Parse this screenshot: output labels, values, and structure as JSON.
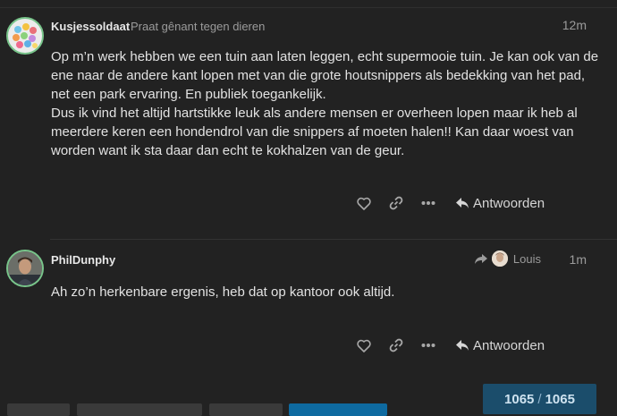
{
  "posts": [
    {
      "username": "Kusjessoldaat",
      "user_title": "Praat gênant tegen dieren",
      "time": "12m",
      "paragraphs": [
        "Op m’n werk hebben we een tuin aan laten leggen, echt supermooie tuin. Je kan ook van de ene naar de andere kant lopen met van die grote houtsnippers als bedekking van het pad, net een park ervaring. En publiek toegankelijk.",
        "Dus ik vind het altijd hartstikke leuk als andere mensen er overheen lopen maar ik heb al meerdere keren een hondendrol van die snippers af moeten halen!! Kan daar woest van worden want ik sta daar dan echt te kokhalzen van de geur."
      ],
      "reply_label": "Antwoorden"
    },
    {
      "username": "PhilDunphy",
      "reply_to_user": "Louis",
      "time": "1m",
      "paragraphs": [
        "Ah zo’n herkenbare ergenis, heb dat op kantoor ook altijd."
      ],
      "reply_label": "Antwoorden"
    }
  ],
  "icons": {
    "like": "heart-icon",
    "link": "link-icon",
    "more": "ellipsis-icon",
    "reply": "reply-arrow-icon",
    "reply_to": "share-arrow-icon"
  },
  "progress": {
    "current": "1065",
    "total": "1065"
  },
  "colors": {
    "background": "#222222",
    "avatar_ring": "#78c48a",
    "progress_bg": "#1b4d6b",
    "primary_button": "#0e6aa0"
  }
}
